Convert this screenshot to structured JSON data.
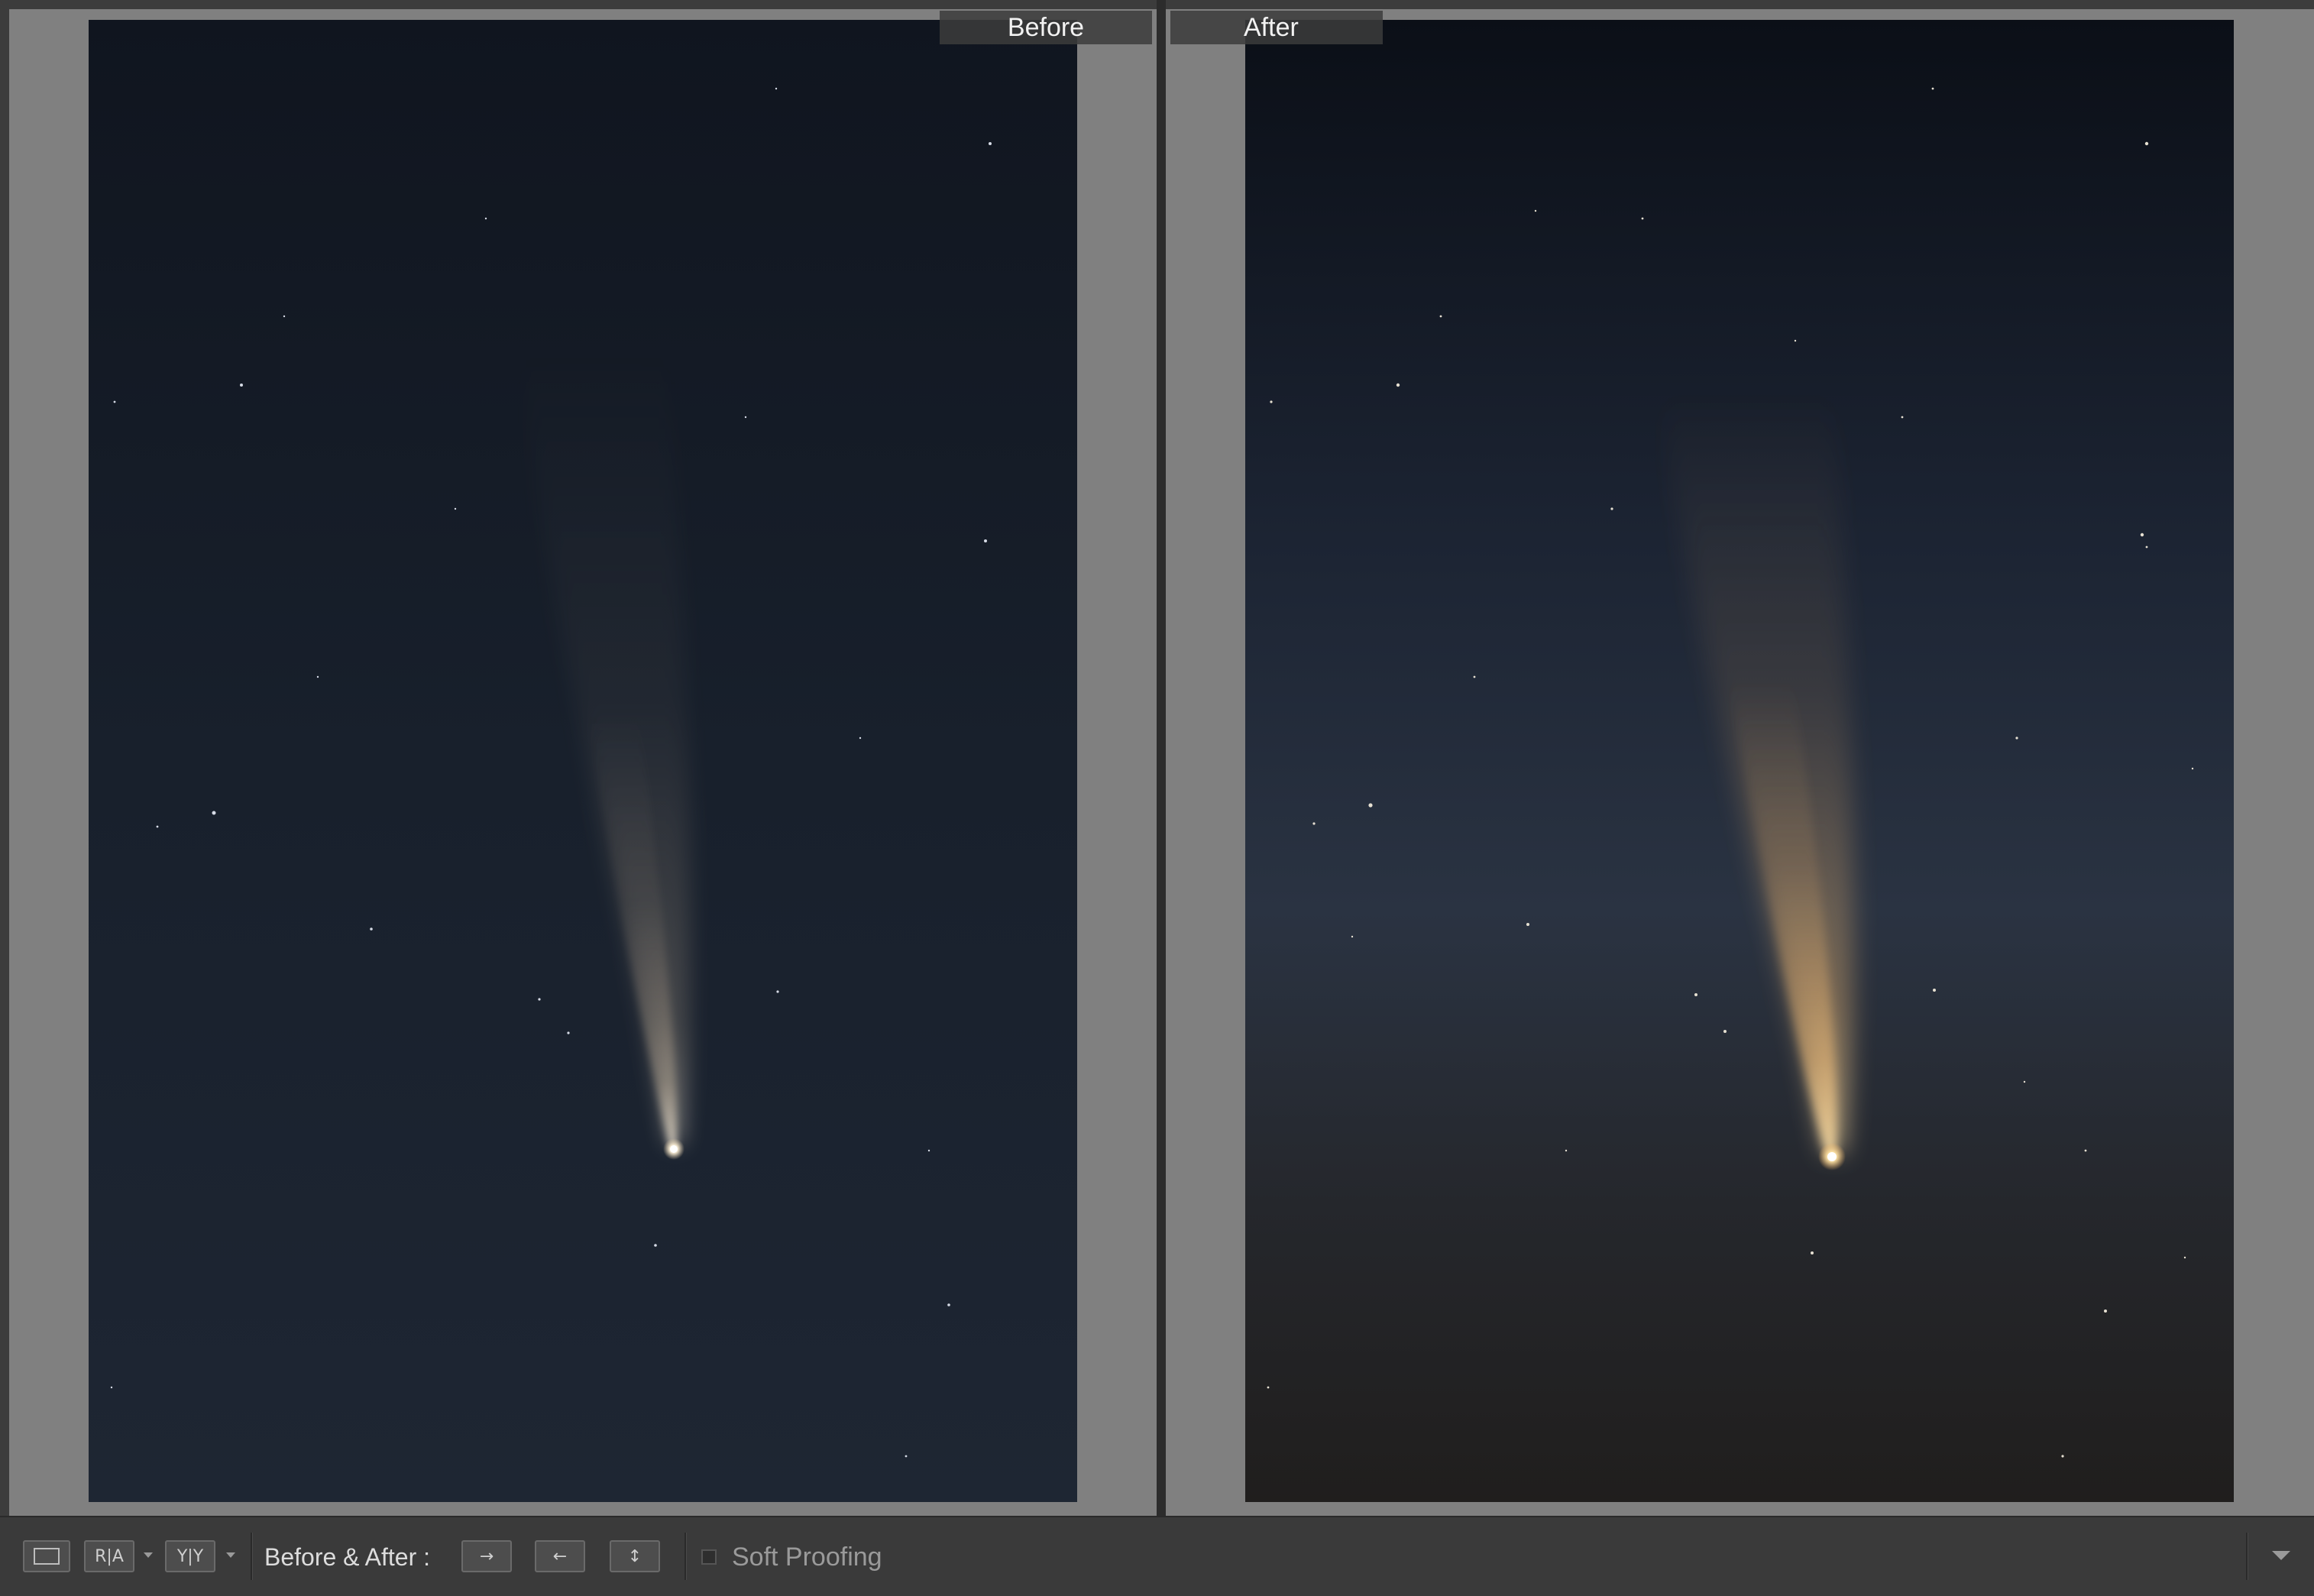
{
  "compare": {
    "before_label": "Before",
    "after_label": "After"
  },
  "toolbar": {
    "view_mode_icon": "single-view-icon",
    "ra_label": "R|A",
    "yy_label": "Y|Y",
    "before_after_label": "Before & After :",
    "copy_before_to_after_icon": "arrow-right-icon",
    "copy_after_to_before_icon": "arrow-left-icon",
    "swap_icon": "swap-vertical-icon",
    "soft_proofing_label": "Soft Proofing",
    "soft_proofing_checked": false,
    "toolbar_menu_icon": "chevron-down-icon"
  },
  "colors": {
    "panel_bg": "#808080",
    "toolbar_bg": "#3a3a3a",
    "sky_before_top": "#10151f",
    "sky_before_bottom": "#1e2633",
    "sky_after_top": "#0b0f17",
    "sky_after_mid": "#2a3342",
    "sky_after_bottom": "#201e1d",
    "comet_before": "#c9b49a",
    "comet_after": "#f5c17a"
  }
}
